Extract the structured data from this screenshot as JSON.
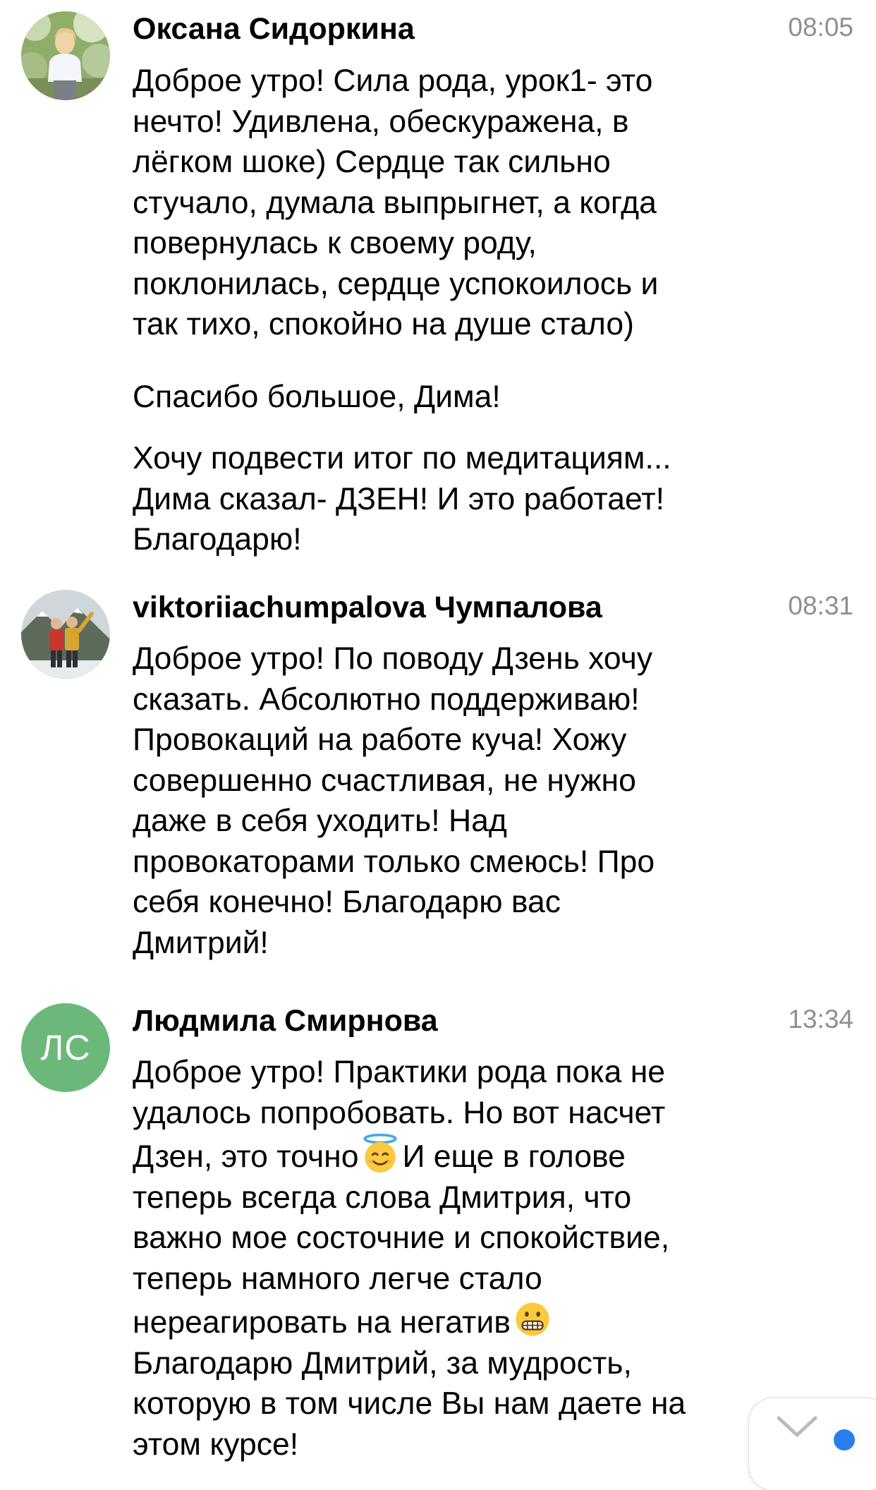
{
  "messages": [
    {
      "author": "Оксана Сидоркина",
      "time": "08:05",
      "avatar": {
        "type": "photo",
        "icon": "woman-portrait"
      },
      "paragraphs": [
        [
          "Доброе утро! Сила рода, урок1- это",
          "нечто! Удивлена, обескуражена, в",
          "лёгком шоке) Сердце так сильно",
          "стучало, думала выпрыгнет, а когда",
          "повернулась к своему роду,",
          "поклонилась, сердце успокоилось и",
          "так тихо, спокойно на душе стало)"
        ],
        [
          "Спасибо большое, Дима!"
        ],
        [
          "Хочу подвести итог по медитациям...",
          "Дима сказал- ДЗЕН! И это работает!",
          "Благодарю!"
        ]
      ]
    },
    {
      "author": "viktoriiachumpalova Чумпалова",
      "time": "08:31",
      "avatar": {
        "type": "photo",
        "icon": "couple-mountains-portrait"
      },
      "paragraphs": [
        [
          "Доброе утро! По поводу Дзень хочу",
          "сказать. Абсолютно поддерживаю!",
          "Провокаций на работе куча! Хожу",
          "совершенно счастливая, не нужно",
          "даже в себя уходить! Над",
          "провокаторами только смеюсь! Про",
          "себя конечно! Благодарю вас",
          "Дмитрий!"
        ]
      ]
    },
    {
      "author": "Людмила Смирнова",
      "time": "13:34",
      "avatar": {
        "type": "initials",
        "initials": "ЛС",
        "color": "#6cb87a"
      },
      "lines": {
        "l1": "Доброе утро! Практики рода пока не",
        "l2": "удалось попробовать. Но вот насчет",
        "l3a": "Дзен, это точно",
        "l3b": "И еще в голове",
        "l4": "теперь всегда слова Дмитрия, что",
        "l5": "важно мое состочние и спокойствие,",
        "l6": "теперь намного легче стало",
        "l7a": "нереагировать на негатив",
        "l8": "Благодарю Дмитрий, за мудрость,",
        "l9": "которую в том числе Вы нам даете на",
        "l10": "этом курсе!"
      },
      "emojis": [
        "smiling-face-with-halo",
        "grimacing-face"
      ]
    }
  ],
  "scroll_button": {
    "icon": "chevron-down-icon",
    "indicator": "unread-dot",
    "indicator_color": "#2a7ef0"
  }
}
